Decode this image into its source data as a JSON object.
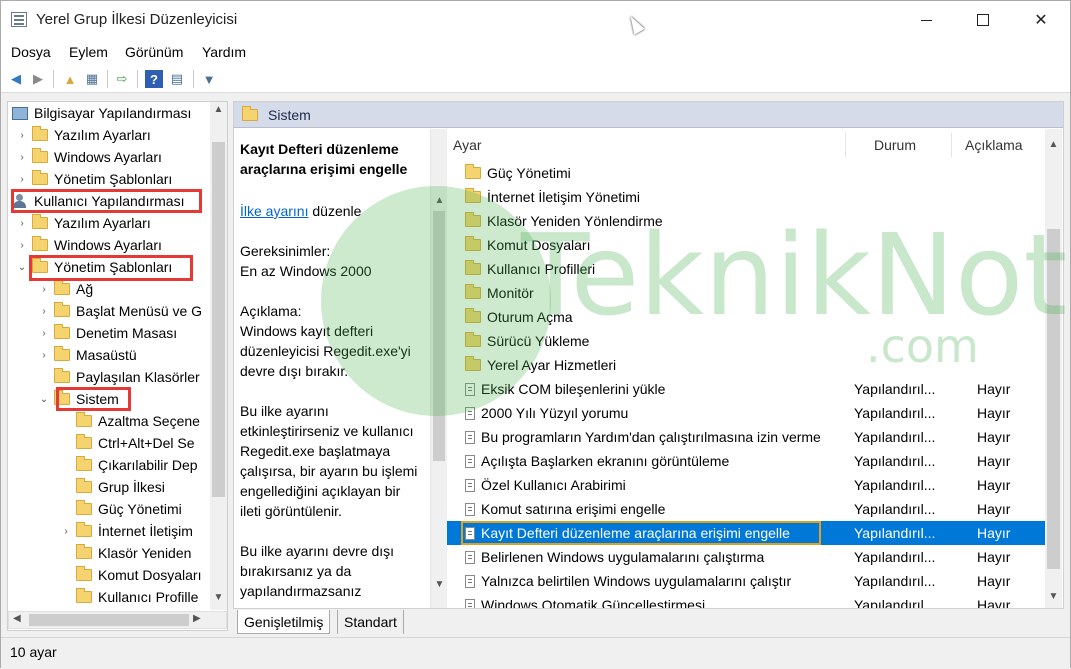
{
  "window": {
    "title": "Yerel Grup İlkesi Düzenleyicisi",
    "minimize_glyph": "",
    "close_glyph": "✕"
  },
  "menu": [
    "Dosya",
    "Eylem",
    "Görünüm",
    "Yardım"
  ],
  "tree": {
    "items": [
      {
        "label": "Bilgisayar Yapılandırması",
        "icon": "computer-icon",
        "expander": ""
      },
      {
        "label": "Yazılım Ayarları",
        "icon": "folder-icon",
        "expander": "›"
      },
      {
        "label": "Windows Ayarları",
        "icon": "folder-icon",
        "expander": "›"
      },
      {
        "label": "Yönetim Şablonları",
        "icon": "folder-icon",
        "expander": "›"
      },
      {
        "label": "Kullanıcı Yapılandırması",
        "icon": "user-icon",
        "expander": ""
      },
      {
        "label": "Yazılım Ayarları",
        "icon": "folder-icon",
        "expander": "›"
      },
      {
        "label": "Windows Ayarları",
        "icon": "folder-icon",
        "expander": "›"
      },
      {
        "label": "Yönetim Şablonları",
        "icon": "folder-icon",
        "expander": "⌄"
      },
      {
        "label": "Ağ",
        "icon": "folder-icon",
        "expander": "›"
      },
      {
        "label": "Başlat Menüsü ve G",
        "icon": "folder-icon",
        "expander": "›"
      },
      {
        "label": "Denetim Masası",
        "icon": "folder-icon",
        "expander": "›"
      },
      {
        "label": "Masaüstü",
        "icon": "folder-icon",
        "expander": "›"
      },
      {
        "label": "Paylaşılan Klasörler",
        "icon": "folder-icon",
        "expander": ""
      },
      {
        "label": "Sistem",
        "icon": "folder-icon",
        "expander": "⌄"
      },
      {
        "label": "Azaltma Seçene",
        "icon": "folder-icon",
        "expander": ""
      },
      {
        "label": "Ctrl+Alt+Del Se",
        "icon": "folder-icon",
        "expander": ""
      },
      {
        "label": "Çıkarılabilir Dep",
        "icon": "folder-icon",
        "expander": ""
      },
      {
        "label": "Grup İlkesi",
        "icon": "folder-icon",
        "expander": ""
      },
      {
        "label": "Güç Yönetimi",
        "icon": "folder-icon",
        "expander": ""
      },
      {
        "label": "İnternet İletişim",
        "icon": "folder-icon",
        "expander": "›"
      },
      {
        "label": "Klasör Yeniden",
        "icon": "folder-icon",
        "expander": ""
      },
      {
        "label": "Komut Dosyaları",
        "icon": "folder-icon",
        "expander": ""
      },
      {
        "label": "Kullanıcı Profille",
        "icon": "folder-icon",
        "expander": ""
      }
    ]
  },
  "right": {
    "header": "Sistem",
    "description": {
      "title": "Kayıt Defteri düzenleme araçlarına erişimi engelle",
      "link": "İlke ayarını",
      "link_suffix": " düzenle",
      "req_label": "Gereksinimler:",
      "req_value": "En az Windows 2000",
      "desc_label": "Açıklama:",
      "desc_p1": "Windows kayıt defteri düzenleyicisi Regedit.exe'yi devre dışı bırakır.",
      "desc_p2": "Bu ilke ayarını etkinleştirirseniz ve kullanıcı Regedit.exe başlatmaya çalışırsa, bir ayarın bu işlemi engellediğini açıklayan bir ileti görüntülenir.",
      "desc_p3": "Bu ilke ayarını devre dışı bırakırsanız ya da yapılandırmazsanız"
    },
    "columns": {
      "setting": "Ayar",
      "state": "Durum",
      "comment": "Açıklama"
    },
    "rows": [
      {
        "name": "Güç Yönetimi",
        "type": "folder",
        "state": "",
        "comment": ""
      },
      {
        "name": "İnternet İletişim Yönetimi",
        "type": "folder",
        "state": "",
        "comment": ""
      },
      {
        "name": "Klasör Yeniden Yönlendirme",
        "type": "folder",
        "state": "",
        "comment": ""
      },
      {
        "name": "Komut Dosyaları",
        "type": "folder",
        "state": "",
        "comment": ""
      },
      {
        "name": "Kullanıcı Profilleri",
        "type": "folder",
        "state": "",
        "comment": ""
      },
      {
        "name": "Monitör",
        "type": "folder",
        "state": "",
        "comment": ""
      },
      {
        "name": "Oturum Açma",
        "type": "folder",
        "state": "",
        "comment": ""
      },
      {
        "name": "Sürücü Yükleme",
        "type": "folder",
        "state": "",
        "comment": ""
      },
      {
        "name": "Yerel Ayar Hizmetleri",
        "type": "folder",
        "state": "",
        "comment": ""
      },
      {
        "name": "Eksik COM bileşenlerini yükle",
        "type": "setting",
        "state": "Yapılandırıl...",
        "comment": "Hayır"
      },
      {
        "name": "2000 Yılı Yüzyıl yorumu",
        "type": "setting",
        "state": "Yapılandırıl...",
        "comment": "Hayır"
      },
      {
        "name": "Bu programların Yardım'dan çalıştırılmasına izin verme",
        "type": "setting",
        "state": "Yapılandırıl...",
        "comment": "Hayır"
      },
      {
        "name": "Açılışta Başlarken ekranını görüntüleme",
        "type": "setting",
        "state": "Yapılandırıl...",
        "comment": "Hayır"
      },
      {
        "name": "Özel Kullanıcı Arabirimi",
        "type": "setting",
        "state": "Yapılandırıl...",
        "comment": "Hayır"
      },
      {
        "name": "Komut satırına erişimi engelle",
        "type": "setting",
        "state": "Yapılandırıl...",
        "comment": "Hayır"
      },
      {
        "name": "Kayıt Defteri düzenleme araçlarına erişimi engelle",
        "type": "setting",
        "state": "Yapılandırıl...",
        "comment": "Hayır",
        "selected": true
      },
      {
        "name": "Belirlenen Windows uygulamalarını çalıştırma",
        "type": "setting",
        "state": "Yapılandırıl...",
        "comment": "Hayır"
      },
      {
        "name": "Yalnızca belirtilen Windows uygulamalarını çalıştır",
        "type": "setting",
        "state": "Yapılandırıl...",
        "comment": "Hayır"
      },
      {
        "name": "Windows Otomatik Güncelleştirmesi",
        "type": "setting",
        "state": "Yapılandırıl...",
        "comment": "Hayır"
      }
    ]
  },
  "tabs": [
    "Genişletilmiş",
    "Standart"
  ],
  "status": "10 ayar",
  "watermark": {
    "text": "TeknikNot",
    "sub": ".com"
  },
  "colors": {
    "selection": "#0078d7",
    "highlight_red": "#e53935",
    "highlight_orange": "#e0a020"
  }
}
